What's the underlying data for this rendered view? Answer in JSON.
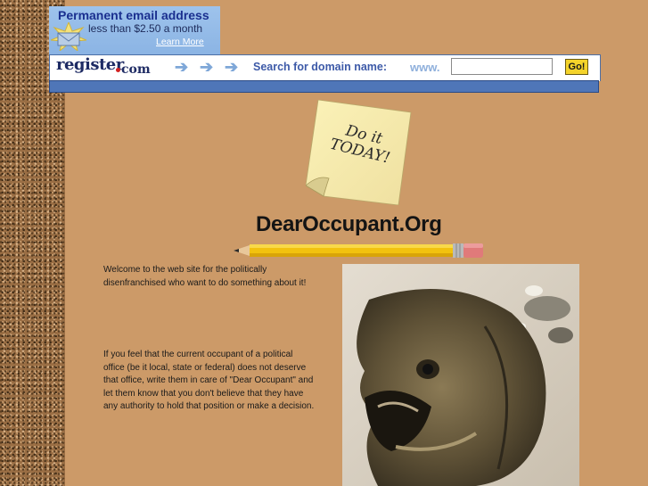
{
  "banner": {
    "promo_title": "Permanent email address",
    "promo_sub": "less than $2.50 a month",
    "promo_link": "Learn More",
    "logo_text": "register",
    "logo_com": "com",
    "search_label": "Search for domain name:",
    "www_label": "www.",
    "domain_input_value": "",
    "go_label": "Go!"
  },
  "sticky_note": {
    "line1": "Do it",
    "line2": "TODAY!"
  },
  "site_title": "DearOccupant.Org",
  "content": {
    "welcome": "Welcome to the web site for the politically disenfranchised who want to do something about it!",
    "body": "If you feel that the current occupant of a political office (be it local, state or federal) does not deserve that office, write them in care of \"Dear Occupant\" and let them know that you don't believe that they have any authority to hold that position or make a decision."
  },
  "colors": {
    "background": "#cc9a68",
    "banner_blue": "#4f76b8",
    "go_button": "#f4d32a"
  }
}
